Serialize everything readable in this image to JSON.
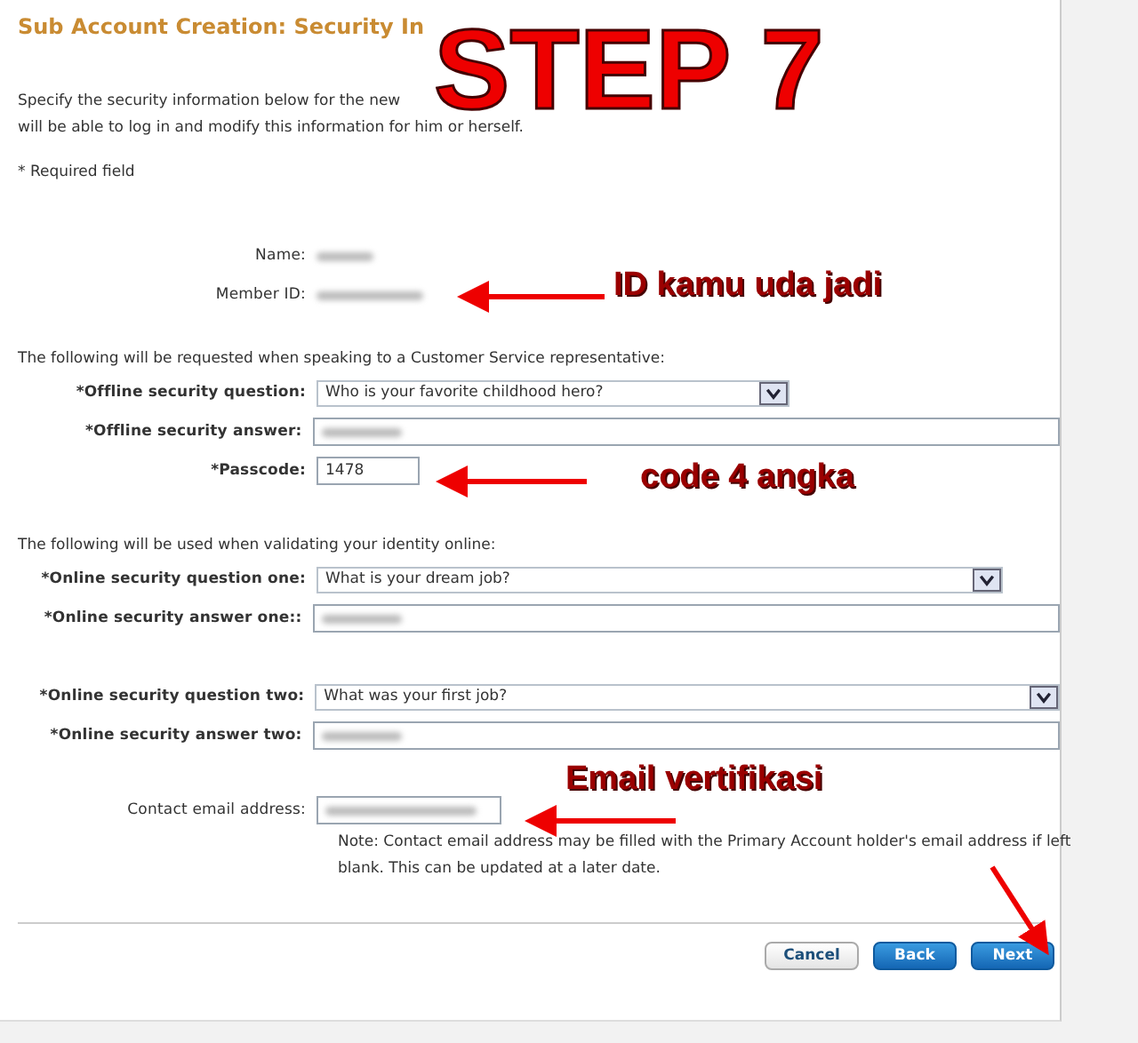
{
  "page": {
    "title": "Sub Account Creation: Security In",
    "intro": [
      "Specify the security information below for the new",
      "will be able to log in and modify this information for him or herself."
    ],
    "required_note": "* Required field"
  },
  "account": [
    {
      "label": "Name:",
      "kind": "blurred"
    },
    {
      "label": "Member ID:",
      "kind": "blurred"
    }
  ],
  "sections": [
    {
      "heading": "The following will be requested when speaking to a Customer Service representative:",
      "fields": [
        {
          "kind": "select",
          "label": "*Offline security question:",
          "value": "Who is your favorite childhood hero?"
        },
        {
          "kind": "blurred",
          "label": "*Offline security answer:"
        },
        {
          "kind": "text",
          "label": "*Passcode:",
          "value": "1478"
        }
      ]
    },
    {
      "heading": "The following will be used when validating your identity online:",
      "fields": [
        {
          "kind": "select",
          "label": "*Online security question one:",
          "value": "What is your dream job?"
        },
        {
          "kind": "blurred",
          "label": "*Online security answer one::"
        },
        {
          "kind": "select",
          "label": "*Online security question two:",
          "value": "What was your first job?"
        },
        {
          "kind": "blurred",
          "label": "*Online security answer two:"
        }
      ]
    }
  ],
  "contact": {
    "label": "Contact email address:",
    "note": "Note: Contact email address may be filled with the Primary Account holder's email address if left blank. This can be updated at a later date."
  },
  "buttons": [
    {
      "label": "Cancel",
      "kind": "secondary"
    },
    {
      "label": "Back",
      "kind": "primary"
    },
    {
      "label": "Next",
      "kind": "primary"
    }
  ],
  "annotations": [
    {
      "kind": "step",
      "text": "STEP 7"
    },
    {
      "kind": "callout",
      "text": "ID kamu uda jadi"
    },
    {
      "kind": "callout",
      "text": "code 4 angka"
    },
    {
      "kind": "callout",
      "text": "Email vertifikasi"
    }
  ]
}
